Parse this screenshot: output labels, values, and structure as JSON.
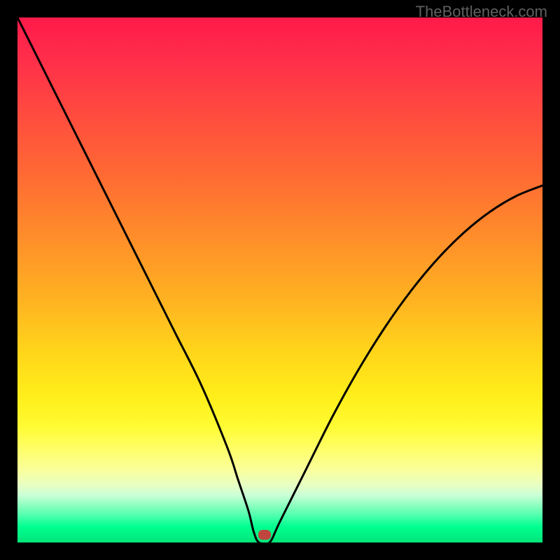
{
  "watermark": "TheBottleneck.com",
  "chart_data": {
    "type": "line",
    "title": "",
    "xlabel": "",
    "ylabel": "",
    "xlim": [
      0,
      100
    ],
    "ylim": [
      0,
      100
    ],
    "series": [
      {
        "name": "curve",
        "x": [
          0,
          5,
          10,
          15,
          20,
          25,
          30,
          35,
          40,
          42,
          44,
          45,
          46,
          48,
          50,
          55,
          60,
          65,
          70,
          75,
          80,
          85,
          90,
          95,
          100
        ],
        "y": [
          100,
          90,
          80,
          70,
          60,
          50,
          40,
          30,
          18,
          12,
          6,
          2,
          0,
          0,
          4,
          14,
          24,
          33,
          41,
          48,
          54,
          59,
          63,
          66,
          68
        ]
      }
    ],
    "marker": {
      "x": 47,
      "y": 1.5
    },
    "gradient": {
      "stops": [
        {
          "pos": 0,
          "color": "#ff1a4a"
        },
        {
          "pos": 50,
          "color": "#ffb321"
        },
        {
          "pos": 80,
          "color": "#ffff66"
        },
        {
          "pos": 100,
          "color": "#00e57a"
        }
      ]
    }
  }
}
